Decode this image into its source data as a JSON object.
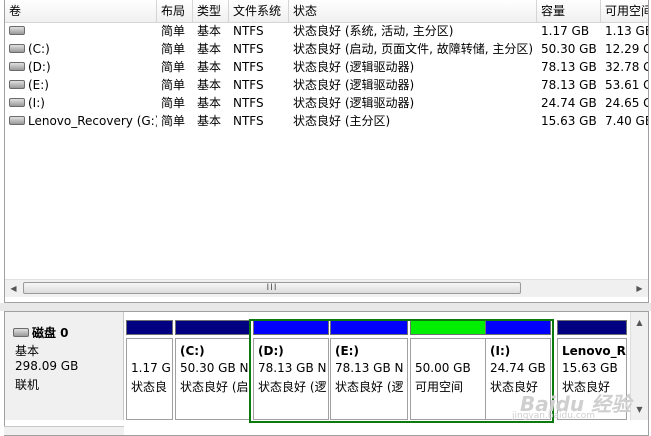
{
  "columns": [
    "卷",
    "布局",
    "类型",
    "文件系统",
    "状态",
    "容量",
    "可用空间"
  ],
  "volumes": [
    {
      "name": "",
      "layout": "简单",
      "type": "基本",
      "fs": "NTFS",
      "status": "状态良好 (系统, 活动, 主分区)",
      "capacity": "1.17 GB",
      "free": "1.13 GB"
    },
    {
      "name": "(C:)",
      "layout": "简单",
      "type": "基本",
      "fs": "NTFS",
      "status": "状态良好 (启动, 页面文件, 故障转储, 主分区)",
      "capacity": "50.30 GB",
      "free": "12.29 G"
    },
    {
      "name": "(D:)",
      "layout": "简单",
      "type": "基本",
      "fs": "NTFS",
      "status": "状态良好 (逻辑驱动器)",
      "capacity": "78.13 GB",
      "free": "32.78 G"
    },
    {
      "name": "(E:)",
      "layout": "简单",
      "type": "基本",
      "fs": "NTFS",
      "status": "状态良好 (逻辑驱动器)",
      "capacity": "78.13 GB",
      "free": "53.61 G"
    },
    {
      "name": "(I:)",
      "layout": "简单",
      "type": "基本",
      "fs": "NTFS",
      "status": "状态良好 (逻辑驱动器)",
      "capacity": "24.74 GB",
      "free": "24.65 G"
    },
    {
      "name": "Lenovo_Recovery (G:)",
      "layout": "简单",
      "type": "基本",
      "fs": "NTFS",
      "status": "状态良好 (主分区)",
      "capacity": "15.63 GB",
      "free": "7.40 GB"
    }
  ],
  "scroll_grip": "III",
  "disk": {
    "name": "磁盘 0",
    "type": "基本",
    "size": "298.09 GB",
    "state": "联机"
  },
  "partitions": [
    {
      "label": "",
      "size": "1.17 G",
      "status": "状态良",
      "bar": "#000080"
    },
    {
      "label": "(C:)",
      "size": "50.30 GB N",
      "status": "状态良好 (启",
      "bar": "#000080"
    },
    {
      "label": "(D:)",
      "size": "78.13 GB N",
      "status": "状态良好 (逻",
      "bar": "#0000ff"
    },
    {
      "label": "(E:)",
      "size": "78.13 GB N",
      "status": "状态良好 (逻",
      "bar": "#0000ff"
    },
    {
      "label": "",
      "size": "50.00 GB",
      "status": "可用空间",
      "bar": "#00ee00"
    },
    {
      "label": "(I:)",
      "size": "24.74 GB",
      "status": "状态良好",
      "bar": "#0000ff"
    },
    {
      "label": "Lenovo_R",
      "size": "15.63 GB",
      "status": "状态良好",
      "bar": "#000080"
    }
  ],
  "watermark": {
    "logo": "Baidu 经验",
    "url": "jingyan.baidu.com"
  },
  "colors": {
    "primary_partition": "#000080",
    "logical_drive": "#0000ff",
    "free_space": "#00ee00",
    "selection": "#0d7a0d"
  }
}
